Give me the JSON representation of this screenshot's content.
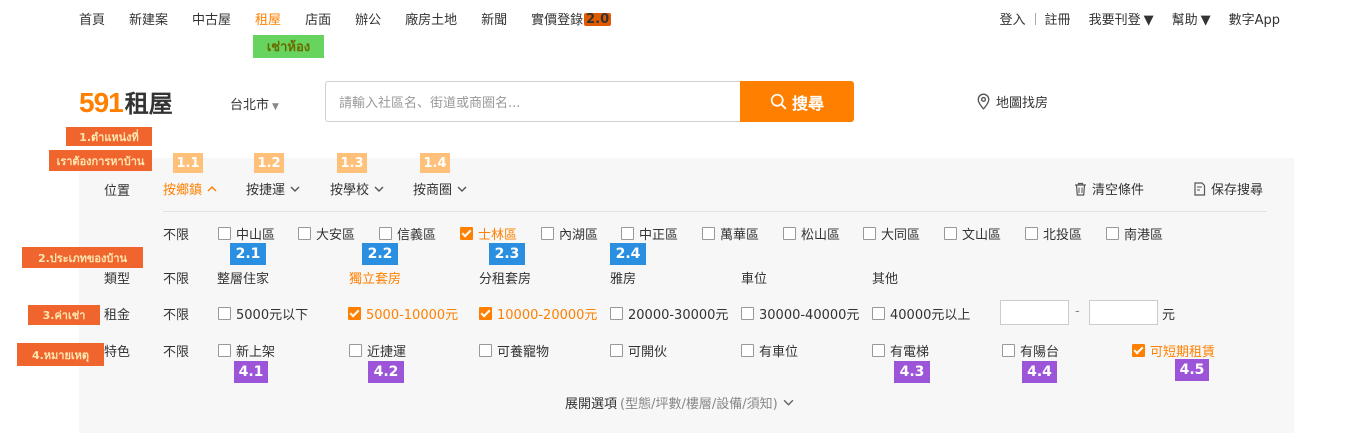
{
  "topnav": {
    "left": [
      "首頁",
      "新建案",
      "中古屋",
      "租屋",
      "店面",
      "辦公",
      "廠房土地",
      "新聞",
      "實價登錄"
    ],
    "badge": "2.0",
    "right": {
      "login": "登入",
      "register": "註冊",
      "post": "我要刊登",
      "help": "幫助",
      "app": "數字App"
    }
  },
  "green_tag": "เช่าห้อง",
  "logo": {
    "num": "591",
    "text": "租屋"
  },
  "city": "台北市",
  "search": {
    "placeholder": "請輸入社區名、街道或商圈名...",
    "button": "搜尋"
  },
  "map_search": "地圖找房",
  "annotations": {
    "red1a": "1.ตำแหน่งที่",
    "red1b": "เราต้องการหาบ้าน",
    "red2": "2.ประเภทของบ้าน",
    "red3": "3.ค่าเช่า",
    "red4": "4.หมายเหตุ",
    "loc": [
      "1.1",
      "1.2",
      "1.3",
      "1.4"
    ],
    "type": [
      "2.1",
      "2.2",
      "2.3",
      "2.4"
    ],
    "feat": [
      "4.1",
      "4.2",
      "4.3",
      "4.4",
      "4.5"
    ]
  },
  "location": {
    "label": "位置",
    "tabs": [
      "按鄉鎮",
      "按捷運",
      "按學校",
      "按商圈"
    ],
    "clear": "清空條件",
    "save": "保存搜尋",
    "any": "不限",
    "districts": [
      {
        "name": "中山區",
        "checked": false
      },
      {
        "name": "大安區",
        "checked": false
      },
      {
        "name": "信義區",
        "checked": false
      },
      {
        "name": "士林區",
        "checked": true
      },
      {
        "name": "內湖區",
        "checked": false
      },
      {
        "name": "中正區",
        "checked": false
      },
      {
        "name": "萬華區",
        "checked": false
      },
      {
        "name": "松山區",
        "checked": false
      },
      {
        "name": "大同區",
        "checked": false
      },
      {
        "name": "文山區",
        "checked": false
      },
      {
        "name": "北投區",
        "checked": false
      },
      {
        "name": "南港區",
        "checked": false
      }
    ]
  },
  "type": {
    "label": "類型",
    "any": "不限",
    "options": [
      "整層住家",
      "獨立套房",
      "分租套房",
      "雅房",
      "車位",
      "其他"
    ]
  },
  "rent": {
    "label": "租金",
    "any": "不限",
    "options": [
      {
        "name": "5000元以下",
        "checked": false
      },
      {
        "name": "5000-10000元",
        "checked": true
      },
      {
        "name": "10000-20000元",
        "checked": true
      },
      {
        "name": "20000-30000元",
        "checked": false
      },
      {
        "name": "30000-40000元",
        "checked": false
      },
      {
        "name": "40000元以上",
        "checked": false
      }
    ],
    "dash": "-",
    "unit": "元"
  },
  "feature": {
    "label": "特色",
    "any": "不限",
    "options": [
      {
        "name": "新上架",
        "checked": false
      },
      {
        "name": "近捷運",
        "checked": false
      },
      {
        "name": "可養寵物",
        "checked": false
      },
      {
        "name": "可開伙",
        "checked": false
      },
      {
        "name": "有車位",
        "checked": false
      },
      {
        "name": "有電梯",
        "checked": false
      },
      {
        "name": "有陽台",
        "checked": false
      },
      {
        "name": "可短期租賃",
        "checked": true
      }
    ]
  },
  "expand": {
    "main": "展開選項",
    "sub": "(型態/坪數/樓層/設備/須知)"
  },
  "colors": {
    "accent": "#ff8000",
    "red_tag": "#f0642e",
    "blue_tag": "#2a8fe0",
    "purple_tag": "#9c55d9",
    "green_tag": "#66d45e"
  }
}
